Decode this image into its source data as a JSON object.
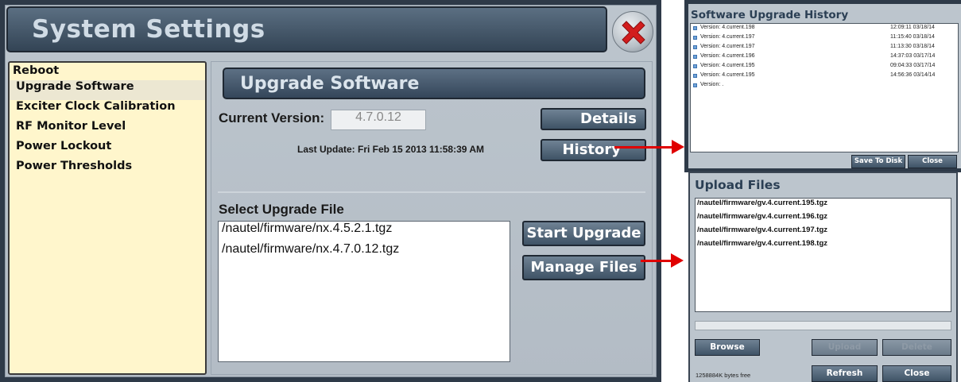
{
  "main_window": {
    "title": "System Settings",
    "sidebar": {
      "items": [
        {
          "label": "Reboot"
        },
        {
          "label": "Upgrade Software"
        },
        {
          "label": "Exciter Clock Calibration"
        },
        {
          "label": "RF Monitor Level"
        },
        {
          "label": "Power Lockout"
        },
        {
          "label": "Power Thresholds"
        }
      ],
      "selected": "Upgrade Software"
    },
    "content": {
      "section_title": "Upgrade Software",
      "current_version_label": "Current Version:",
      "current_version_value": "4.7.0.12",
      "last_update": "Last Update: Fri Feb 15 2013 11:58:39 AM",
      "details_button": "Details",
      "history_button": "History",
      "select_file_label": "Select Upgrade File",
      "files": [
        "/nautel/firmware/nx.4.5.2.1.tgz",
        "/nautel/firmware/nx.4.7.0.12.tgz"
      ],
      "start_upgrade_button": "Start Upgrade",
      "manage_files_button": "Manage Files"
    }
  },
  "history_popup": {
    "title": "Software Upgrade History",
    "entries": [
      {
        "version": "Version: 4.current.198",
        "timestamp": "12:09:11 03/18/14"
      },
      {
        "version": "Version: 4.current.197",
        "timestamp": "11:15:40 03/18/14"
      },
      {
        "version": "Version: 4.current.197",
        "timestamp": "11:13:30 03/18/14"
      },
      {
        "version": "Version: 4.current.196",
        "timestamp": "14:37:03 03/17/14"
      },
      {
        "version": "Version: 4.current.195",
        "timestamp": "09:04:33 03/17/14"
      },
      {
        "version": "Version: 4.current.195",
        "timestamp": "14:56:36 03/14/14"
      },
      {
        "version": "Version: .",
        "timestamp": ""
      }
    ],
    "save_button": "Save To Disk",
    "close_button": "Close"
  },
  "upload_popup": {
    "title": "Upload Files",
    "files": [
      "/nautel/firmware/gv.4.current.195.tgz",
      "/nautel/firmware/gv.4.current.196.tgz",
      "/nautel/firmware/gv.4.current.197.tgz",
      "/nautel/firmware/gv.4.current.198.tgz"
    ],
    "browse_button": "Browse",
    "upload_button": "Upload",
    "delete_button": "Delete",
    "free_space": "1258884K bytes free",
    "refresh_button": "Refresh",
    "close_button": "Close"
  },
  "colors": {
    "title_bar": "#334455",
    "sidebar_bg": "#fff6cc",
    "panel_bg": "#bcc5cd",
    "arrow": "#e00000",
    "close_icon": "#d21d1d"
  }
}
